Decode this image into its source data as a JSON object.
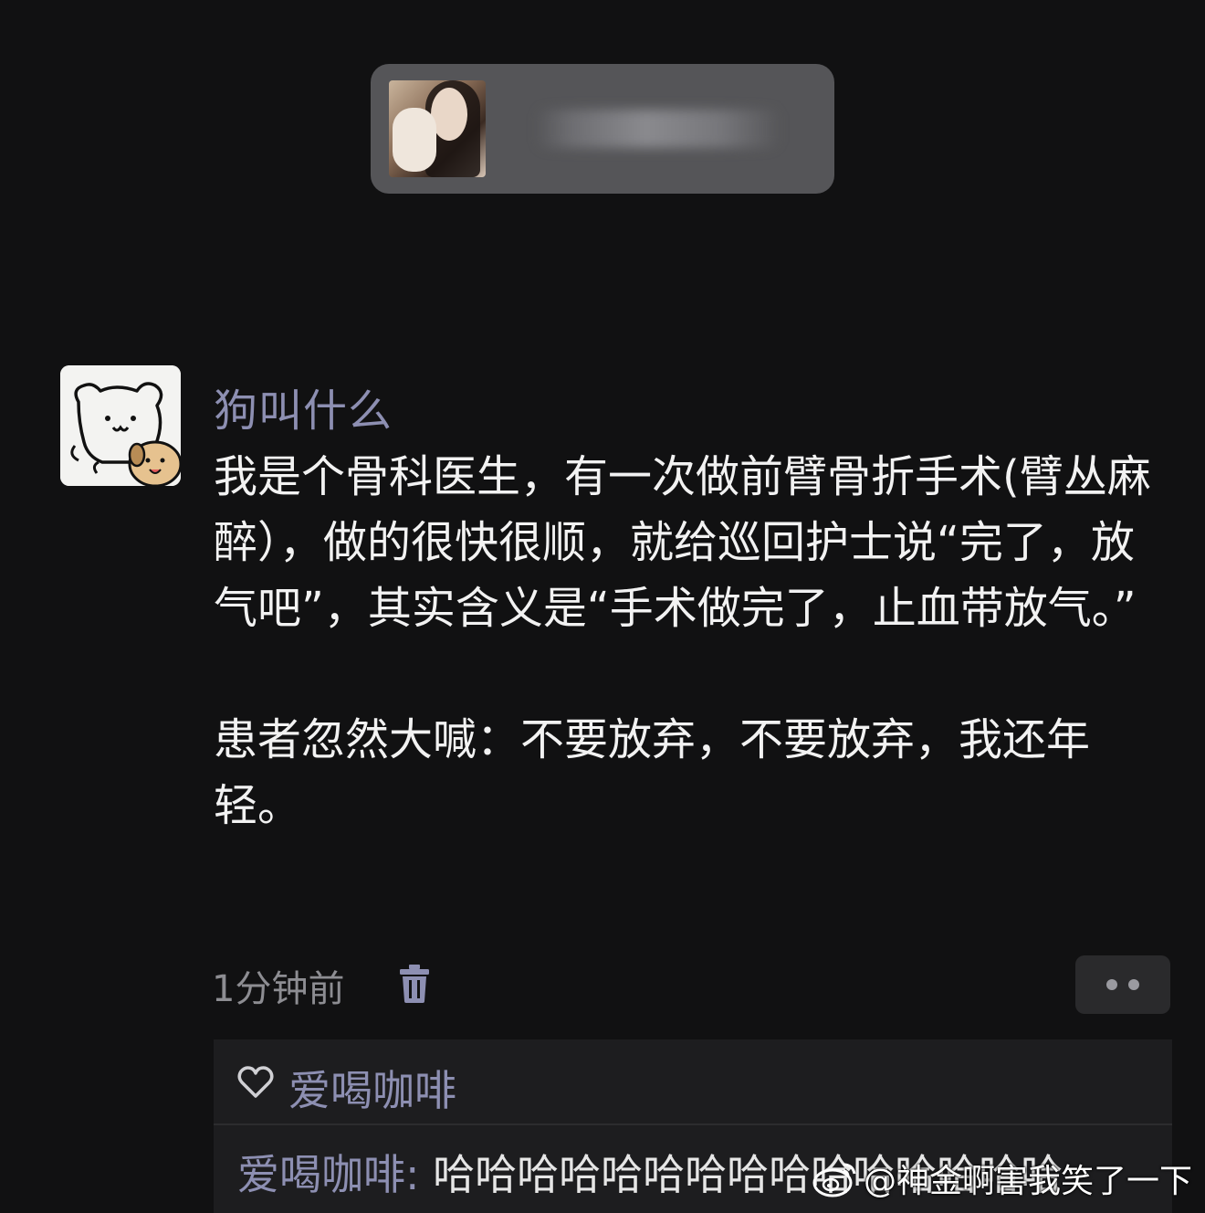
{
  "post": {
    "author": "狗叫什么",
    "paragraph_1": "我是个骨科医生，有一次做前臂骨折手术(臂丛麻醉），做的很快很顺，就给巡回护士说“完了，放气吧”，其实含义是“手术做完了，止血带放气。”",
    "paragraph_2": "患者忽然大喊：不要放弃，不要放弃，我还年轻。",
    "time": "1分钟前"
  },
  "likes": {
    "names": "爱喝咖啡"
  },
  "reply": {
    "author": "爱喝咖啡:",
    "text": " 哈哈哈哈哈哈哈哈哈哈哈哈哈哈哈"
  },
  "watermark": {
    "text": "@神金啊害我笑了一下"
  },
  "icons": {
    "delete": "trash-icon",
    "like": "heart-icon",
    "more": "more-dots-icon",
    "brand": "weibo-icon"
  }
}
